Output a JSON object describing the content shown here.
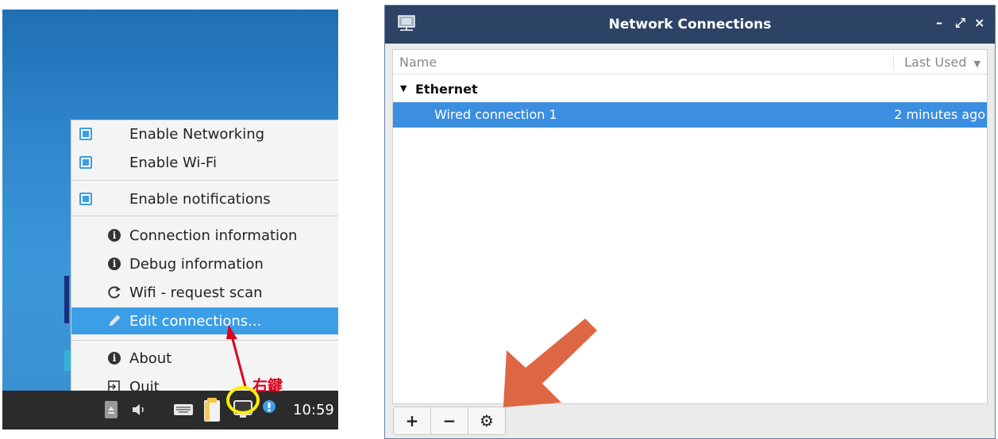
{
  "menu": {
    "items": [
      {
        "label": "Enable Networking",
        "checked": true
      },
      {
        "label": "Enable Wi-Fi",
        "checked": true
      },
      {
        "label": "Enable notifications",
        "checked": true
      },
      {
        "label": "Connection information",
        "icon": "info-icon"
      },
      {
        "label": "Debug information",
        "icon": "info-icon"
      },
      {
        "label": "Wifi - request scan",
        "icon": "refresh-icon"
      },
      {
        "label": "Edit connections...",
        "icon": "pencil-icon",
        "highlighted": true
      },
      {
        "label": "About",
        "icon": "info-icon"
      },
      {
        "label": "Quit",
        "icon": "exit-icon"
      }
    ]
  },
  "taskbar": {
    "clock": "10:59"
  },
  "annotation": {
    "label": "右鍵",
    "color": "#d9001b",
    "circle_color": "#ffee00",
    "arrow_color": "#dd6644"
  },
  "window": {
    "title": "Network Connections",
    "minimize_label": "–",
    "restore_label": "⤢",
    "close_label": "×",
    "columns": {
      "name": "Name",
      "last_used": "Last Used"
    },
    "groups": [
      {
        "name": "Ethernet",
        "connections": [
          {
            "name": "Wired connection 1",
            "last_used": "2 minutes ago",
            "selected": true
          }
        ]
      }
    ],
    "toolbar": {
      "add_label": "+",
      "remove_label": "−",
      "settings_label": "⚙"
    }
  },
  "colors": {
    "menu_highlight": "#3b9ee6",
    "titlebar": "#2d4366",
    "selection": "#3b8ee0"
  }
}
